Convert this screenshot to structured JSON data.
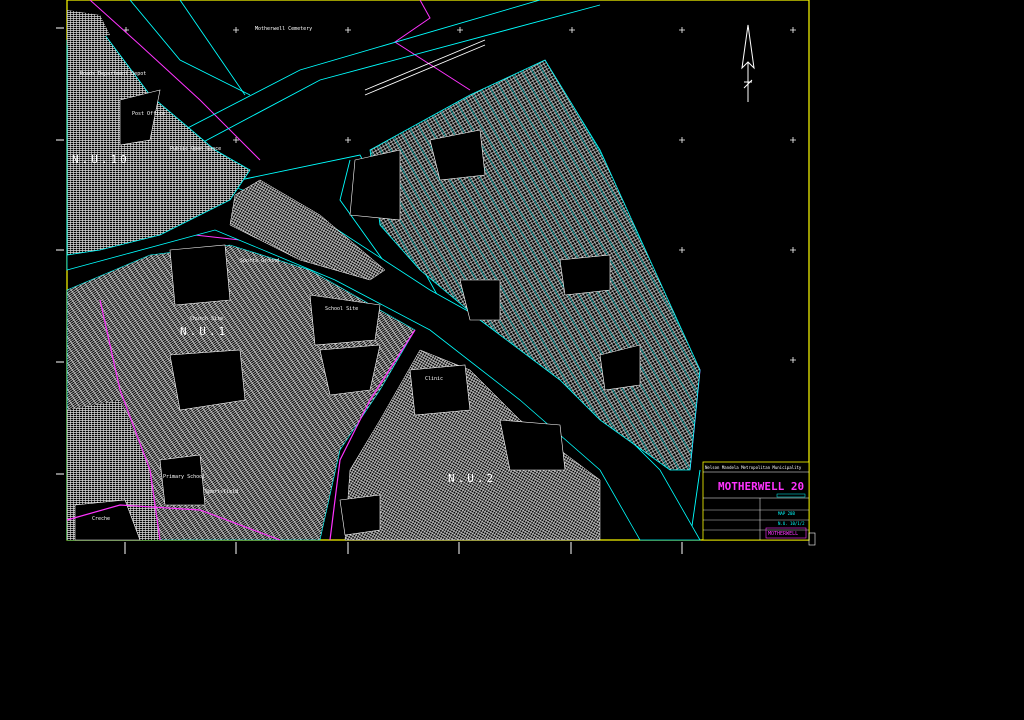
{
  "map": {
    "title": "MOTHERWELL 20",
    "block_labels": [
      "N.U.10",
      "N.U.1",
      "N.U.2"
    ],
    "area_labels": {
      "cemetery": "Motherwell Cemetery",
      "north_left": "Roads Department Depot",
      "post_office": "Post Office",
      "proposed": "Public Open Space",
      "sports_ground": "Sports Ground",
      "school": "School Site",
      "church": "Church Site",
      "primary_school": "Primary School",
      "sportsfield": "Sportsfield",
      "creche": "Creche",
      "clinic": "Clinic"
    }
  },
  "title_block": {
    "header": "Nelson Mandela Metropolitan Municipality",
    "title": "MOTHERWELL 20",
    "rows": [
      "MAP 20B",
      "N.U. 10/1/2"
    ],
    "stamp": "MOTHERWELL"
  },
  "colors": {
    "frame": "#ffff00",
    "boundary": "#ff33ff",
    "roads": "#00ffff",
    "parcels": "#ffffff",
    "background": "#000000"
  },
  "icons": [
    "north-arrow-icon"
  ]
}
